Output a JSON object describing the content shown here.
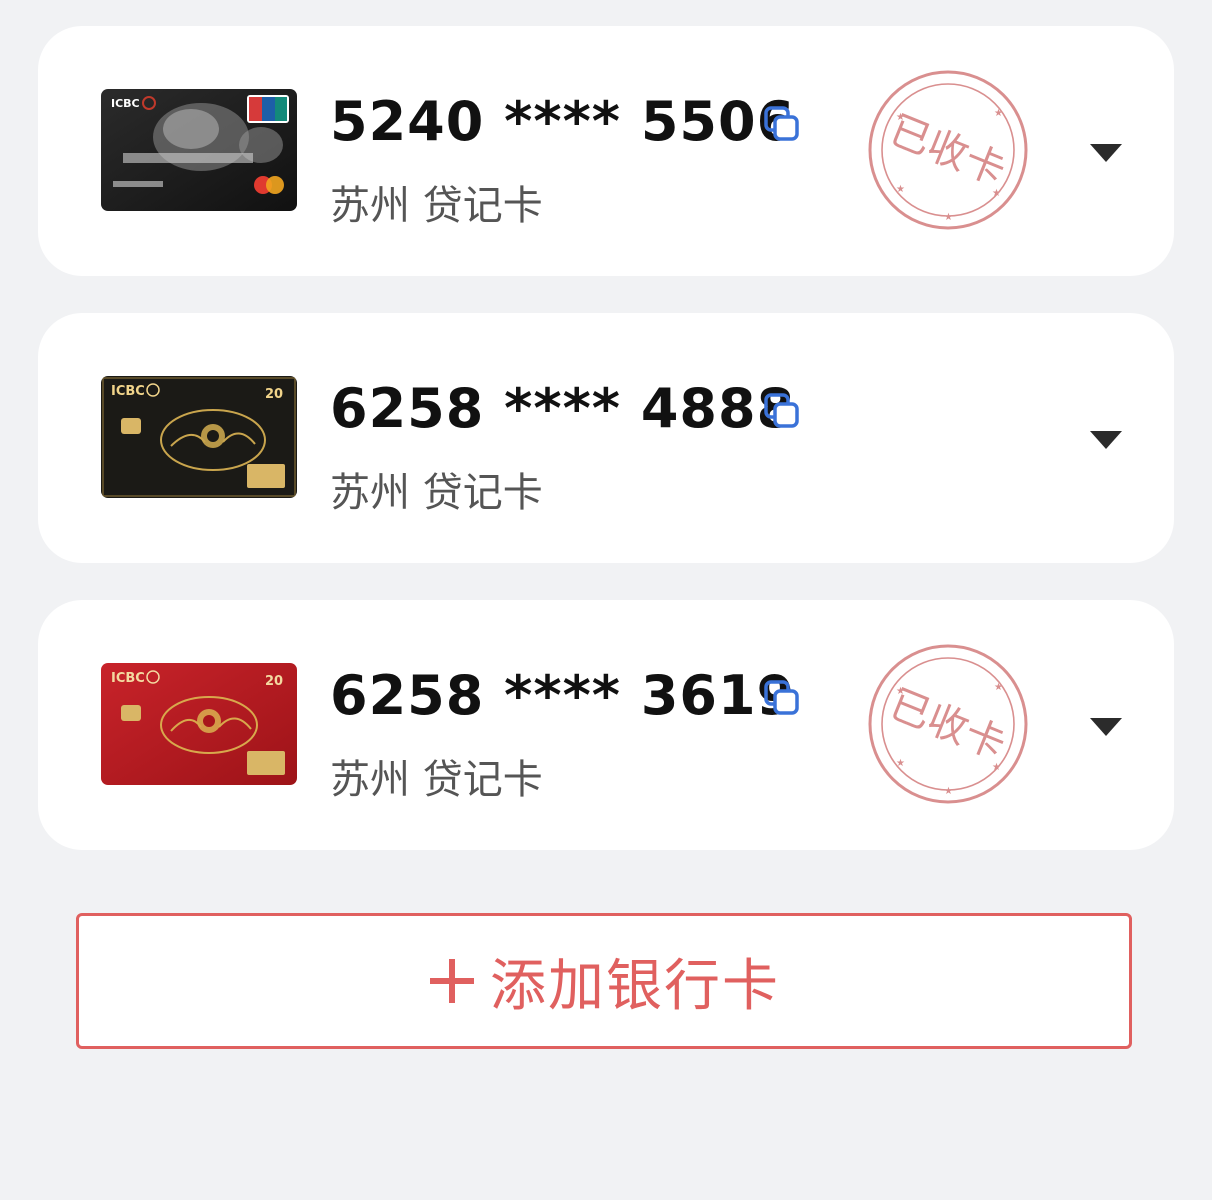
{
  "cards": [
    {
      "number": "5240 **** 5506",
      "location_type": "苏州 贷记卡",
      "stamp_text": "已收卡",
      "show_stamp": true,
      "card_style": "black-mastercard",
      "card_text": "ICBC",
      "icons": {
        "copy": "copy-icon",
        "expand": "chevron-down-icon"
      }
    },
    {
      "number": "6258 **** 4888",
      "location_type": "苏州 贷记卡",
      "stamp_text": "",
      "show_stamp": false,
      "card_style": "black-gold",
      "card_text": "ICBC",
      "icons": {
        "copy": "copy-icon",
        "expand": "chevron-down-icon"
      }
    },
    {
      "number": "6258 **** 3619",
      "location_type": "苏州 贷记卡",
      "stamp_text": "已收卡",
      "show_stamp": true,
      "card_style": "red-gold",
      "card_text": "ICBC",
      "icons": {
        "copy": "copy-icon",
        "expand": "chevron-down-icon"
      }
    }
  ],
  "add_button": {
    "icon": "plus-icon",
    "label": "添加银行卡"
  },
  "colors": {
    "background": "#f1f2f4",
    "card_bg": "#ffffff",
    "accent_red": "#e0605f",
    "copy_blue": "#3a72d8",
    "stamp_red": "#d98f8f",
    "text_primary": "#111111",
    "text_secondary": "#555555"
  }
}
